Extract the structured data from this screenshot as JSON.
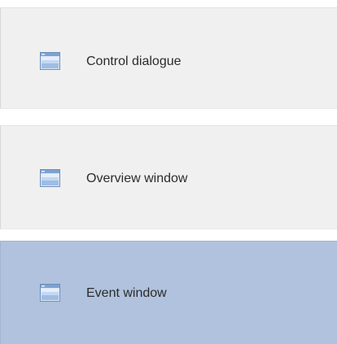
{
  "items": [
    {
      "label": "Control dialogue",
      "icon": "window-icon",
      "selected": false
    },
    {
      "label": "Overview window",
      "icon": "window-icon",
      "selected": false
    },
    {
      "label": "Event window",
      "icon": "window-icon",
      "selected": true
    }
  ],
  "colors": {
    "item_background": "#f0f0f0",
    "selected_background": "#b0c2dd",
    "text": "#2b2b2b",
    "icon_frame": "#5a7fb0",
    "icon_body": "#cfe0f5"
  }
}
